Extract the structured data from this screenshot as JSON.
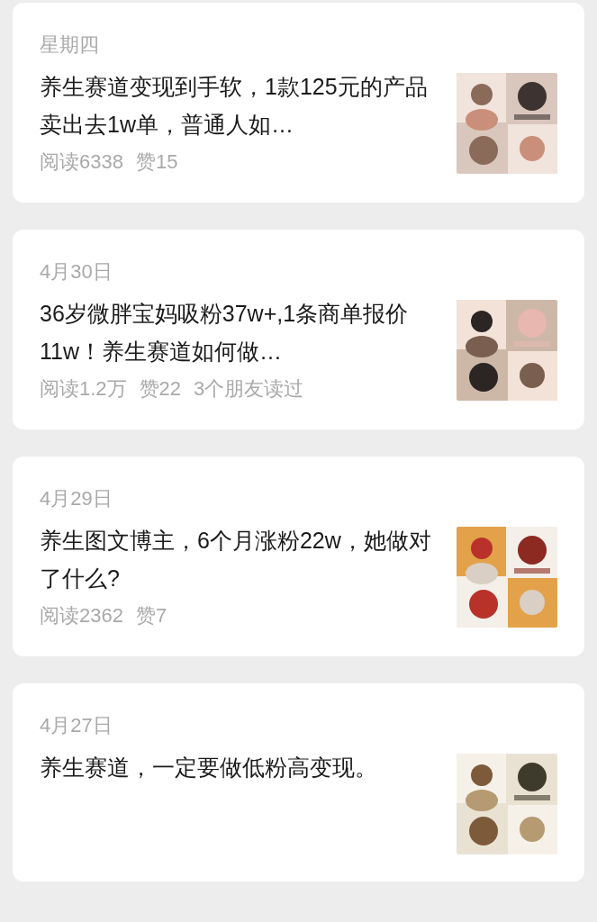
{
  "articles": [
    {
      "date": "星期四",
      "title": "养生赛道变现到手软，1款125元的产品卖出去1w单，普通人如…",
      "stats": [
        "阅读6338",
        "赞15"
      ],
      "thumbnail": {
        "kind": "picture"
      }
    },
    {
      "date": "4月30日",
      "title": "36岁微胖宝妈吸粉37w+,1条商单报价11w！养生赛道如何做…",
      "stats": [
        "阅读1.2万",
        "赞22",
        "3个朋友读过"
      ],
      "thumbnail": {
        "kind": "picture"
      }
    },
    {
      "date": "4月29日",
      "title": "养生图文博主，6个月涨粉22w，她做对了什么?",
      "stats": [
        "阅读2362",
        "赞7"
      ],
      "thumbnail": {
        "kind": "picture"
      }
    },
    {
      "date": "4月27日",
      "title": "养生赛道，一定要做低粉高变现。",
      "thumbnail": {
        "kind": "picture"
      }
    }
  ]
}
